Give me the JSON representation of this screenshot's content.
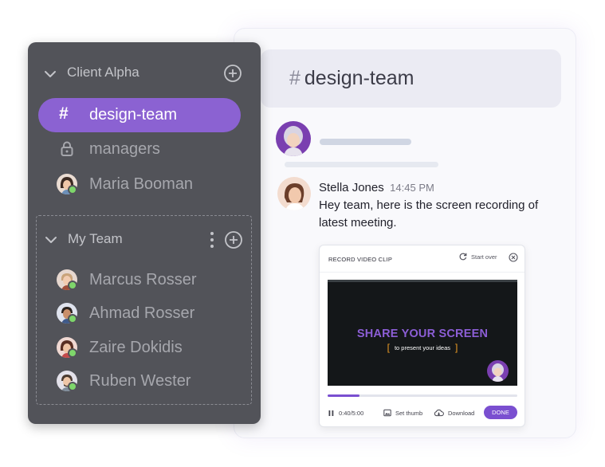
{
  "sidebar": {
    "workspace": {
      "name": "Client Alpha"
    },
    "channels": [
      {
        "name": "design-team",
        "prefix": "#",
        "active": true
      },
      {
        "name": "managers",
        "icon": "lock-icon"
      }
    ],
    "direct_messages": [
      {
        "name": "Maria Booman",
        "status": "online"
      }
    ],
    "team": {
      "name": "My Team",
      "members": [
        {
          "name": "Marcus Rosser",
          "status": "online"
        },
        {
          "name": "Ahmad Rosser",
          "status": "online"
        },
        {
          "name": "Zaire Dokidis",
          "status": "online"
        },
        {
          "name": "Ruben Wester",
          "status": "online"
        }
      ]
    }
  },
  "chat": {
    "channel": {
      "hash": "#",
      "name": "design-team"
    },
    "message": {
      "sender": "Stella Jones",
      "time": "14:45 PM",
      "text": "Hey team, here is the screen recording of latest meeting."
    },
    "video_clip": {
      "title": "RECORD VIDEO CLIP",
      "start_over_label": "Start over",
      "headline": "SHARE YOUR SCREEN",
      "subtext": "to present your ideas",
      "bracket_left": "[",
      "bracket_right": "]",
      "time": "0:40/5:00",
      "progress": 0.17,
      "set_thumb_label": "Set thumb",
      "download_label": "Download",
      "done_label": "DONE"
    }
  },
  "colors": {
    "accent": "#8b62d2",
    "sidebar_bg": "#525359",
    "status_online": "#7ed66b",
    "highlight_orange": "#f3a125"
  }
}
